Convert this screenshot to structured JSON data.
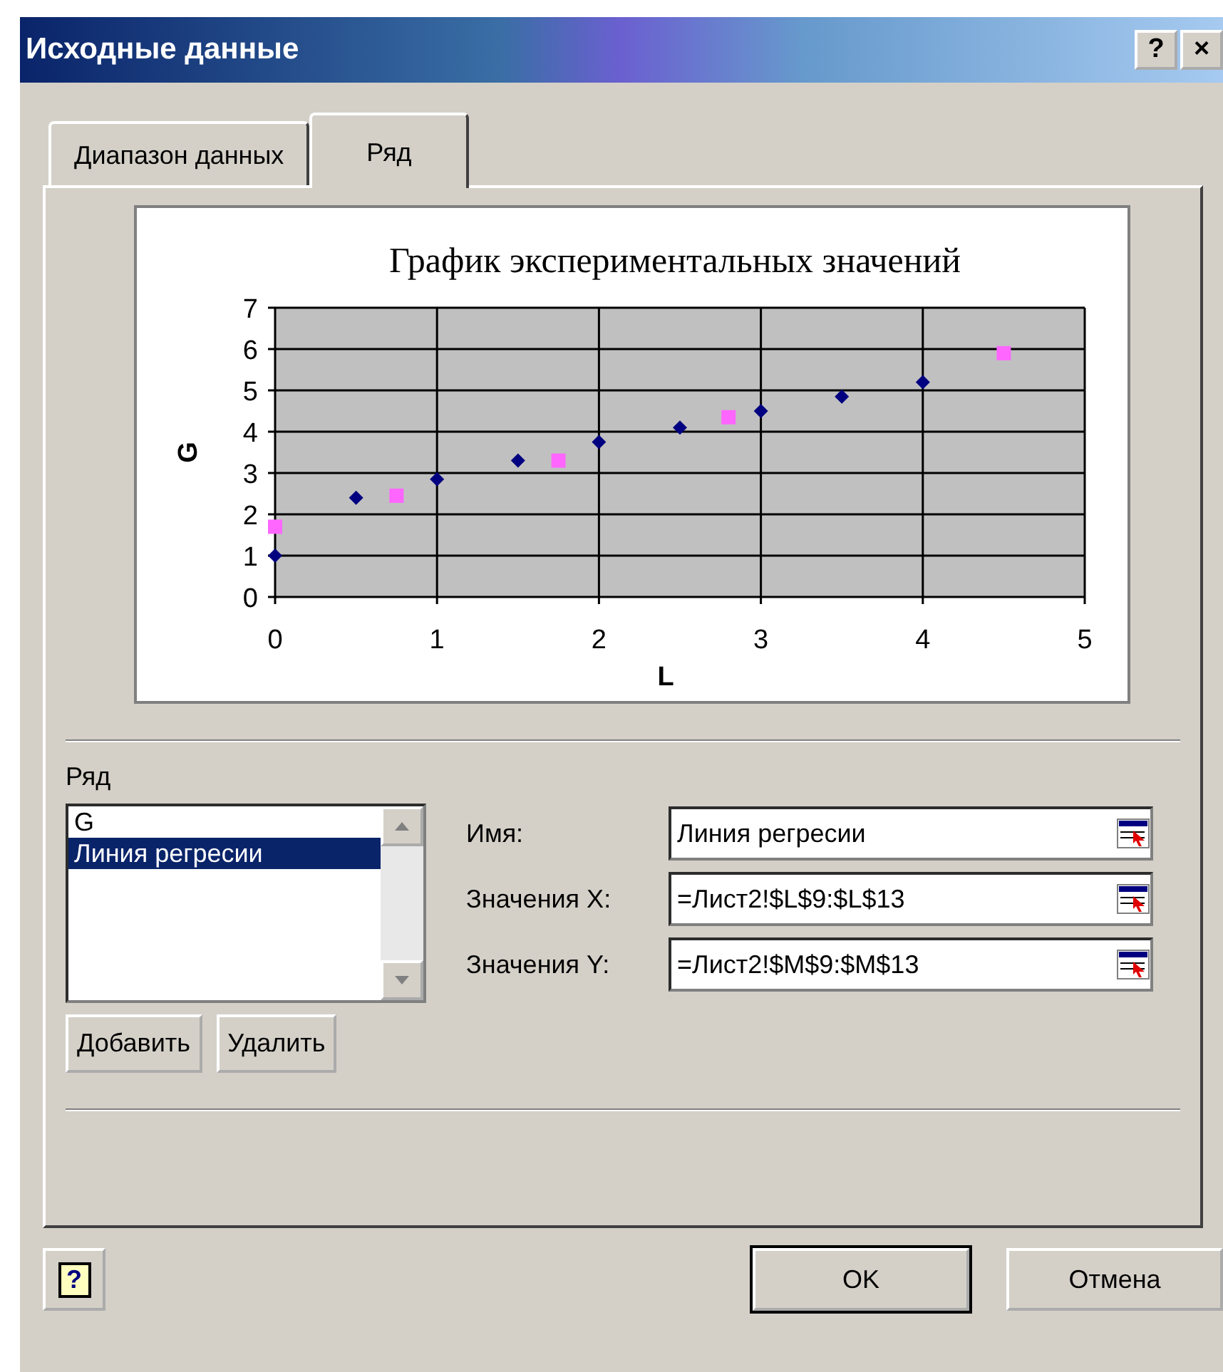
{
  "window": {
    "title": "Исходные данные",
    "title_buttons": [
      "?",
      "×"
    ]
  },
  "tabs": [
    {
      "label": "Диапазон данных",
      "selected": false
    },
    {
      "label": "Ряд",
      "selected": true
    }
  ],
  "chart": {
    "chart_data": {
      "type": "scatter",
      "title": "График экспериментальных значений",
      "xlabel": "L",
      "ylabel": "G",
      "xlim": [
        0,
        5
      ],
      "ylim": [
        0,
        7
      ],
      "xticks": [
        0,
        1,
        2,
        3,
        4,
        5
      ],
      "yticks": [
        0,
        1,
        2,
        3,
        4,
        5,
        6,
        7
      ],
      "grid": true,
      "series": [
        {
          "color": "#000080",
          "x": [
            0,
            0.5,
            1,
            1.5,
            2,
            2.5,
            3,
            3.5,
            4
          ],
          "values": [
            1,
            2.4,
            2.85,
            3.3,
            3.75,
            4.1,
            4.5,
            4.85,
            5.2
          ]
        },
        {
          "color": "#ff66ff",
          "x": [
            0,
            0.75,
            1.75,
            2.8,
            4.5
          ],
          "values": [
            1.7,
            2.45,
            3.3,
            4.35,
            5.9
          ]
        }
      ]
    }
  },
  "series_panel": {
    "label": "Ряд",
    "items": [
      {
        "label": "G",
        "selected": false
      },
      {
        "label": "Линия регресии",
        "selected": true
      }
    ],
    "buttons": [
      "Добавить",
      "Удалить"
    ]
  },
  "fields": [
    {
      "label": "Имя:",
      "value": "Линия регресии"
    },
    {
      "label": "Значения X:",
      "value": "=Лист2!$L$9:$L$13"
    },
    {
      "label": "Значения Y:",
      "value": "=Лист2!$M$9:$M$13"
    }
  ],
  "footer": {
    "help": "?",
    "buttons": [
      "OK",
      "Отмена"
    ]
  }
}
